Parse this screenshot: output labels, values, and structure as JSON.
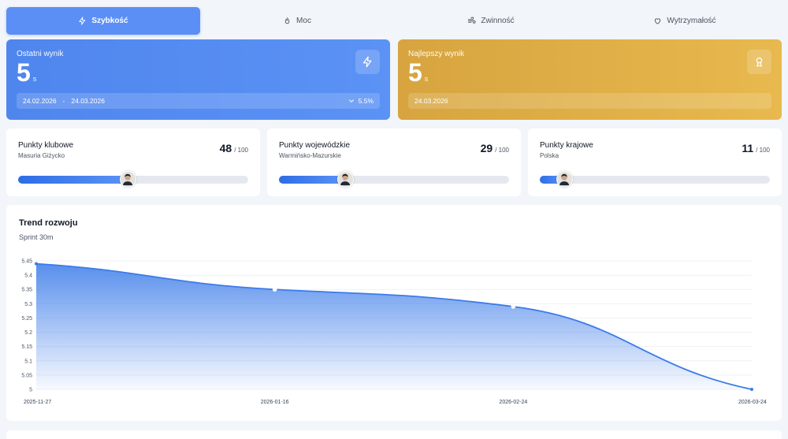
{
  "tabs": [
    {
      "label": "Szybkość",
      "icon": "lightning-icon",
      "active": true
    },
    {
      "label": "Moc",
      "icon": "flame-icon",
      "active": false
    },
    {
      "label": "Zwinność",
      "icon": "wind-icon",
      "active": false
    },
    {
      "label": "Wytrzymałość",
      "icon": "heart-icon",
      "active": false
    }
  ],
  "last_result": {
    "label": "Ostatni wynik",
    "value": "5",
    "unit": "s",
    "date_from": "24.02.2026",
    "date_sep": "-",
    "date_to": "24.03.2026",
    "change": "5.5%",
    "icon": "lightning-icon",
    "color": "#5b8ff5"
  },
  "best_result": {
    "label": "Najlepszy wynik",
    "value": "5",
    "unit": "s",
    "date": "24.03.2026",
    "icon": "award-icon",
    "color": "#e2b048"
  },
  "points": [
    {
      "title": "Punkty klubowe",
      "subtitle": "Masuria Giżycko",
      "score": "48",
      "max": "/ 100",
      "fraction": 0.48
    },
    {
      "title": "Punkty wojewódzkie",
      "subtitle": "Warmińsko-Mazurskie",
      "score": "29",
      "max": "/ 100",
      "fraction": 0.29
    },
    {
      "title": "Punkty krajowe",
      "subtitle": "Polska",
      "score": "11",
      "max": "/ 100",
      "fraction": 0.11
    }
  ],
  "trend": {
    "title": "Trend rozwoju",
    "subtitle": "Sprint 30m"
  },
  "chart_data": {
    "type": "area",
    "x": [
      "2025-11-27",
      "2026-01-16",
      "2026-02-24",
      "2026-03-24"
    ],
    "values": [
      5.44,
      5.35,
      5.29,
      5.0
    ],
    "yticks": [
      "5",
      "5.05",
      "5.1",
      "5.15",
      "5.2",
      "5.25",
      "5.3",
      "5.35",
      "5.4",
      "5.45"
    ],
    "ylim": [
      5,
      5.45
    ],
    "grid": true,
    "color": "#3b7be9"
  }
}
